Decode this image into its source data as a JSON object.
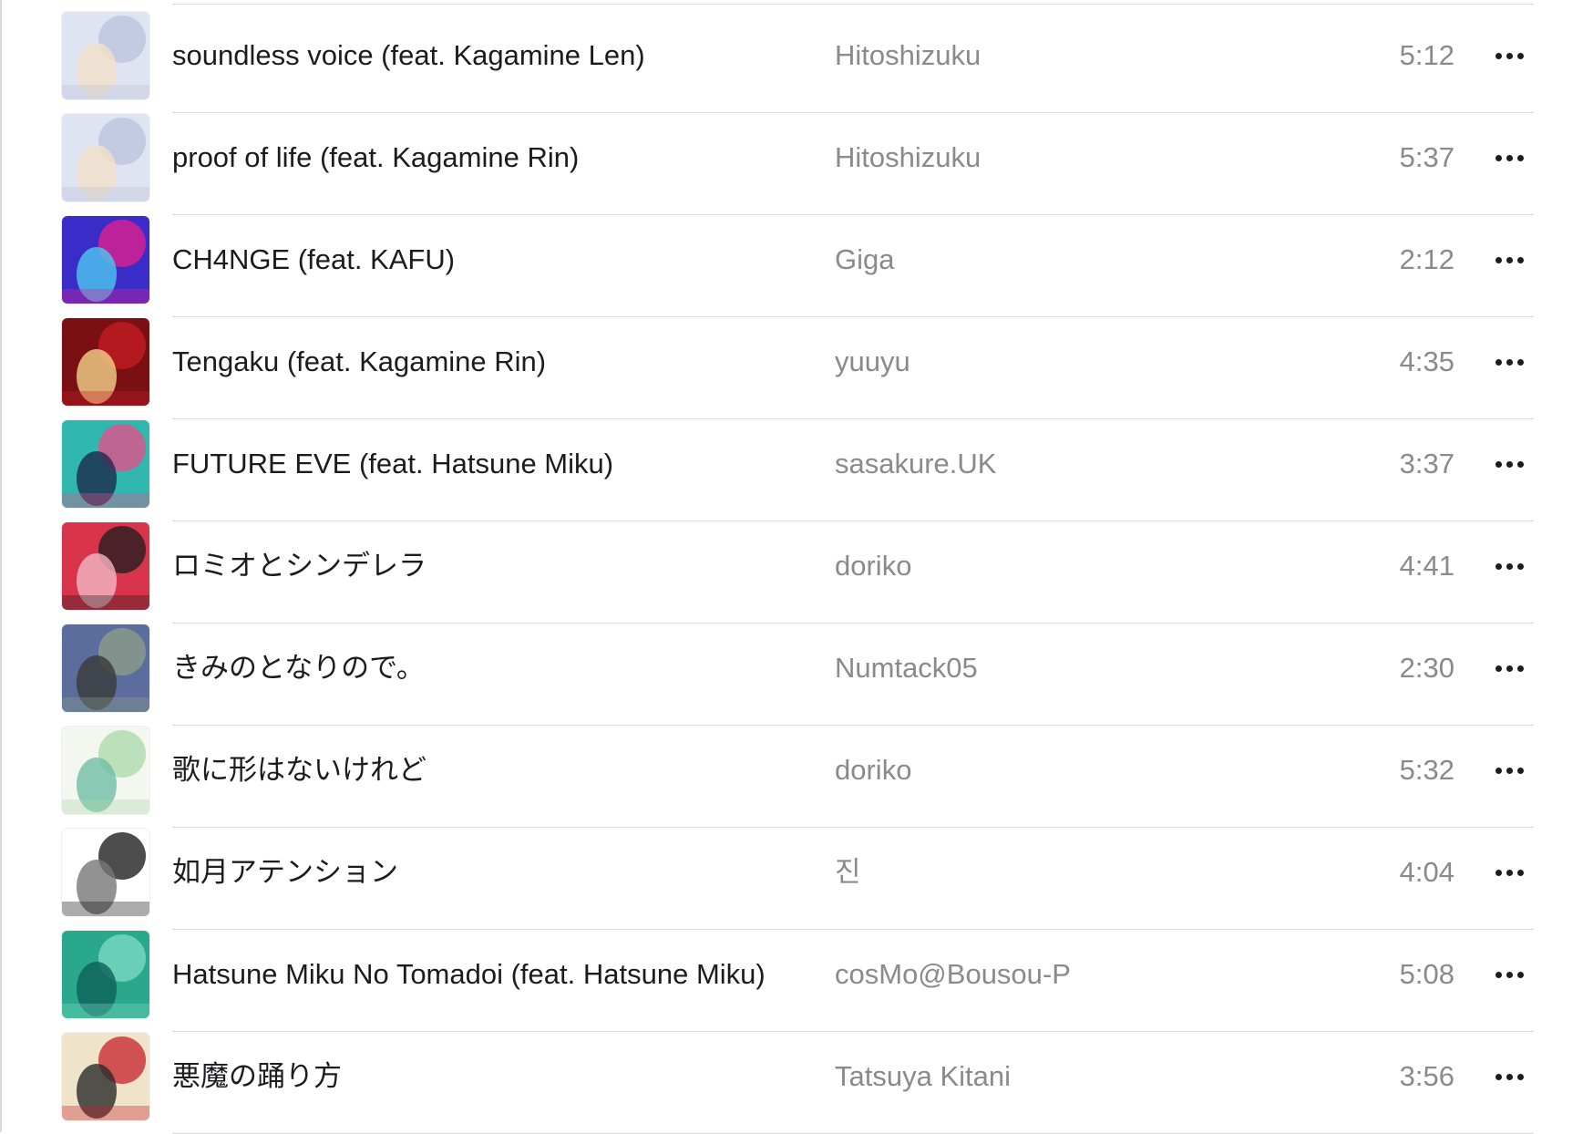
{
  "tracks": [
    {
      "title": "soundless voice (feat. Kagamine Len)",
      "artist": "Hitoshizuku",
      "duration": "5:12",
      "artwork": "rin-len-artwork",
      "colors": [
        "#dfe4f2",
        "#b9c3de",
        "#f3e0c8"
      ]
    },
    {
      "title": "proof of life (feat. Kagamine Rin)",
      "artist": "Hitoshizuku",
      "duration": "5:37",
      "artwork": "rin-len-artwork",
      "colors": [
        "#dfe4f2",
        "#b9c3de",
        "#f3e0c8"
      ]
    },
    {
      "title": "CH4NGE (feat. KAFU)",
      "artist": "Giga",
      "duration": "2:12",
      "artwork": "kafu-artwork",
      "colors": [
        "#3a2cc8",
        "#e8208c",
        "#4cc8f0"
      ]
    },
    {
      "title": "Tengaku (feat. Kagamine Rin)",
      "artist": "yuuyu",
      "duration": "4:35",
      "artwork": "tengaku-artwork",
      "colors": [
        "#7a0f14",
        "#c81e23",
        "#f4d38a"
      ]
    },
    {
      "title": "FUTURE EVE (feat. Hatsune Miku)",
      "artist": "sasakure.UK",
      "duration": "3:37",
      "artwork": "future-eve-artwork",
      "colors": [
        "#2fb7b0",
        "#f04a88",
        "#1d2b4c"
      ]
    },
    {
      "title": "ロミオとシンデレラ",
      "artist": "doriko",
      "duration": "4:41",
      "artwork": "romeo-cinderella-artwork",
      "colors": [
        "#d8344b",
        "#1c1c1c",
        "#f2b8c3"
      ]
    },
    {
      "title": "きみのとなりので。",
      "artist": "Numtack05",
      "duration": "2:30",
      "artwork": "kimino-tonari-artwork",
      "colors": [
        "#5b6d9c",
        "#8fa08a",
        "#3a3a3a"
      ]
    },
    {
      "title": "歌に形はないけれど",
      "artist": "doriko",
      "duration": "5:32",
      "artwork": "uta-ni-katachi-artwork",
      "colors": [
        "#f4f6f0",
        "#a8d8a8",
        "#6fbfa5"
      ]
    },
    {
      "title": "如月アテンション",
      "artist": "진",
      "duration": "4:04",
      "artwork": "kisaragi-attention-artwork",
      "colors": [
        "#ffffff",
        "#111111",
        "#777777"
      ]
    },
    {
      "title": "Hatsune Miku No Tomadoi (feat. Hatsune Miku)",
      "artist": "cosMo@Bousou-P",
      "duration": "5:08",
      "artwork": "miku-tomadoi-artwork",
      "colors": [
        "#2aa88c",
        "#7fdcc4",
        "#0e5f5a"
      ]
    },
    {
      "title": "悪魔の踊り方",
      "artist": "Tatsuya Kitani",
      "duration": "3:56",
      "artwork": "akuma-no-odorikata-artwork",
      "colors": [
        "#efe3c9",
        "#c8202a",
        "#2a2a2a"
      ]
    }
  ],
  "more_icon": "ellipsis-icon"
}
